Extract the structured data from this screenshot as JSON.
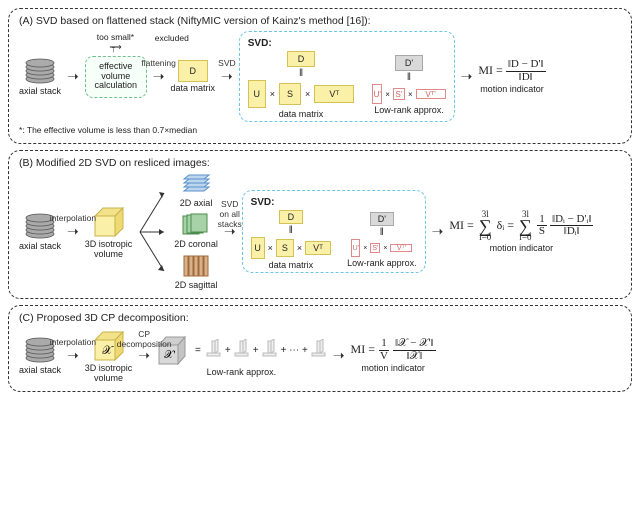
{
  "panelA": {
    "title": "(A) SVD based on flattened stack (NiftyMIC version of Kainz's method [16]):",
    "axial_label": "axial stack",
    "effective_box": "effective\nvolume\ncalculation",
    "branch_label": "too small*",
    "branch_target": "excluded",
    "arrow_flatten": "flattening",
    "D_label": "D",
    "data_matrix": "data matrix",
    "arrow_svd": "SVD",
    "svd_title": "SVD:",
    "U": "U",
    "S": "S",
    "VT": "Vᵀ",
    "Dp": "D'",
    "Up": "U'",
    "Sp": "S'",
    "VTp": "Vᵀ'",
    "low_rank": "Low-rank approx.",
    "motion_indicator": "motion indicator",
    "mi_lhs": "MI =",
    "mi_num": "‖D − D'‖",
    "mi_den": "‖D‖",
    "footnote": "*: The effective volume is less than 0.7×median"
  },
  "panelB": {
    "title": "(B) Modified 2D SVD on resliced images:",
    "axial_label": "axial stack",
    "arrow_interp": "interpolation",
    "iso_label": "3D isotropic\nvolume",
    "twoD_axial": "2D axial",
    "twoD_coronal": "2D coronal",
    "twoD_sagittal": "2D sagittal",
    "arrow_svd": "SVD\non all\nstacks",
    "svd_title": "SVD:",
    "D": "D",
    "U": "U",
    "S": "S",
    "VT": "Vᵀ",
    "Dp": "D'",
    "Up": "U'",
    "Sp": "S'",
    "VTp": "Vᵀ'",
    "data_matrix": "data matrix",
    "low_rank": "Low-rank approx.",
    "motion_indicator": "motion indicator",
    "mi_lhs": "MI =",
    "sum_top": "3l",
    "sum_bot": "l=0",
    "delta": "δᵢ =",
    "inner_pre": "1",
    "inner_pre_den": "S",
    "inner_num": "‖Dᵢ − D'ᵢ‖",
    "inner_den": "‖Dᵢ‖"
  },
  "panelC": {
    "title": "(C) Proposed 3D CP decomposition:",
    "axial_label": "axial stack",
    "arrow_interp": "interpolation",
    "iso_label": "3D isotropic\nvolume",
    "X": "𝒳",
    "arrow_cp": "CP\ndecomposition",
    "Xp": "𝒳'",
    "plus_dots": "+ ⋯ +",
    "low_rank": "Low-rank approx.",
    "motion_indicator": "motion indicator",
    "mi_lhs": "MI =",
    "mi_pre_num": "1",
    "mi_pre_den": "V",
    "mi_num": "‖𝒳 − 𝒳'‖",
    "mi_den": "‖𝒳‖"
  }
}
